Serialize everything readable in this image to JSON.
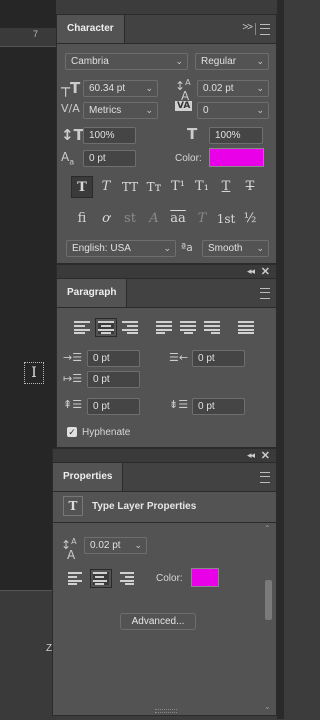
{
  "ruler": {
    "mark": "7"
  },
  "canvas_bottom": {
    "text": "Z"
  },
  "character": {
    "tab": "Character",
    "font_family": "Cambria",
    "font_style": "Regular",
    "font_size": "60.34 pt",
    "leading": "0.02 pt",
    "kerning": "Metrics",
    "tracking": "0",
    "vertical_scale": "100%",
    "horizontal_scale": "100%",
    "baseline_shift": "0 pt",
    "color_label": "Color:",
    "color_value": "#e900e9",
    "type_buttons": [
      "T",
      "T",
      "TT",
      "Tᴛ",
      "T¹",
      "T₁",
      "T",
      "T"
    ],
    "opentype_buttons": [
      "fi",
      "ơ",
      "st",
      "A",
      "aa",
      "T",
      "1st",
      "½"
    ],
    "language": "English: USA",
    "aa_icon": "ªa",
    "antialias": "Smooth"
  },
  "paragraph": {
    "tab": "Paragraph",
    "indent_left": "0 pt",
    "indent_right": "0 pt",
    "indent_first": "0 pt",
    "space_before": "0 pt",
    "space_after": "0 pt",
    "hyphenate_label": "Hyphenate",
    "hyphenate_checked": true
  },
  "properties": {
    "tab": "Properties",
    "layer_icon": "T",
    "layer_title": "Type Layer Properties",
    "leading": "0.02 pt",
    "color_label": "Color:",
    "color_value": "#e900e9",
    "advanced_label": "Advanced..."
  }
}
